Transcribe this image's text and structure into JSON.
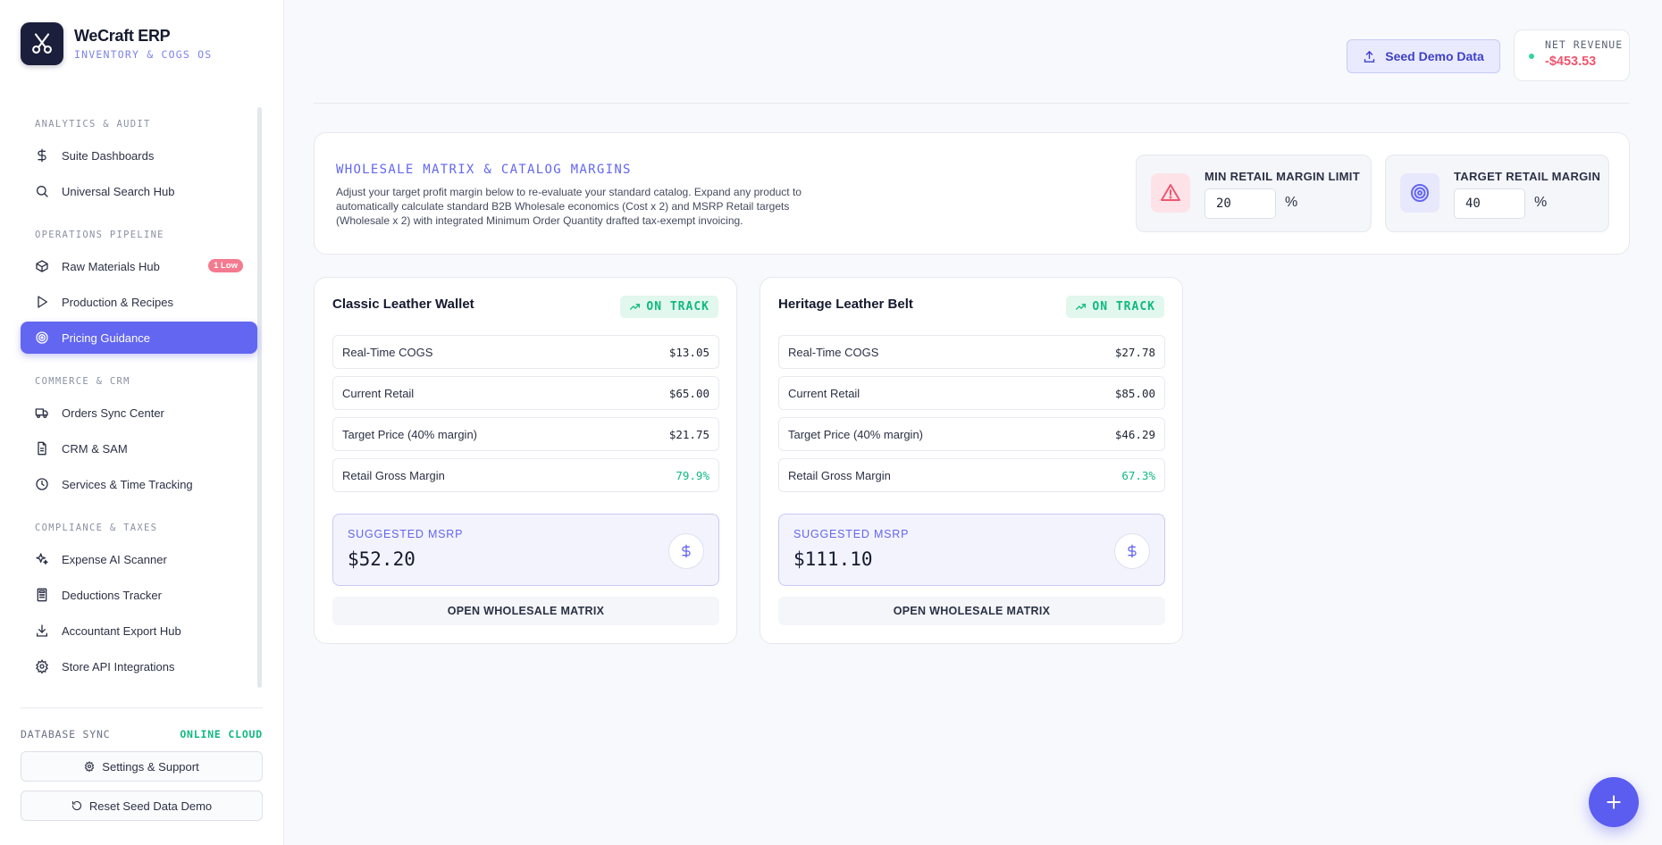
{
  "brand": {
    "name": "WeCraft ERP",
    "subtitle": "INVENTORY & COGS OS"
  },
  "sidebar": {
    "sections": [
      {
        "label": "ANALYTICS & AUDIT",
        "items": [
          {
            "label": "Suite Dashboards",
            "icon": "dollar-icon"
          },
          {
            "label": "Universal Search Hub",
            "icon": "search-icon"
          }
        ]
      },
      {
        "label": "OPERATIONS PIPELINE",
        "items": [
          {
            "label": "Raw Materials Hub",
            "icon": "package-icon",
            "badge": "1 Low"
          },
          {
            "label": "Production & Recipes",
            "icon": "play-icon"
          },
          {
            "label": "Pricing Guidance",
            "icon": "target-icon",
            "active": true
          }
        ]
      },
      {
        "label": "COMMERCE & CRM",
        "items": [
          {
            "label": "Orders Sync Center",
            "icon": "truck-icon"
          },
          {
            "label": "CRM & SAM",
            "icon": "file-icon"
          },
          {
            "label": "Services & Time Tracking",
            "icon": "clock-icon"
          }
        ]
      },
      {
        "label": "COMPLIANCE & TAXES",
        "items": [
          {
            "label": "Expense AI Scanner",
            "icon": "sparkles-icon"
          },
          {
            "label": "Deductions Tracker",
            "icon": "calculator-icon"
          },
          {
            "label": "Accountant Export Hub",
            "icon": "download-icon"
          },
          {
            "label": "Store API Integrations",
            "icon": "gear-icon"
          }
        ]
      }
    ],
    "footer": {
      "db_label": "DATABASE SYNC",
      "db_status": "ONLINE CLOUD",
      "settings_label": "Settings & Support",
      "reset_label": "Reset Seed Data Demo"
    }
  },
  "header": {
    "seed_label": "Seed Demo Data",
    "revenue_label": "NET REVENUE",
    "revenue_value": "-$453.53"
  },
  "info": {
    "title": "WHOLESALE MATRIX & CATALOG MARGINS",
    "description": "Adjust your target profit margin below to re-evaluate your standard catalog. Expand any product to automatically calculate standard B2B Wholesale economics (Cost x 2) and MSRP Retail targets (Wholesale x 2) with integrated Minimum Order Quantity drafted tax-exempt invoicing.",
    "min_margin": {
      "label": "MIN RETAIL MARGIN LIMIT",
      "value": "20",
      "unit": "%"
    },
    "target_margin": {
      "label": "TARGET RETAIL MARGIN",
      "value": "40",
      "unit": "%"
    }
  },
  "products": [
    {
      "name": "Classic Leather Wallet",
      "status": "ON TRACK",
      "rows": [
        {
          "label": "Real-Time COGS",
          "value": "$13.05"
        },
        {
          "label": "Current Retail",
          "value": "$65.00"
        },
        {
          "label": "Target Price (40% margin)",
          "value": "$21.75"
        },
        {
          "label": "Retail Gross Margin",
          "value": "79.9%",
          "highlight": true
        }
      ],
      "msrp_label": "SUGGESTED MSRP",
      "msrp_value": "$52.20",
      "button_label": "OPEN WHOLESALE MATRIX"
    },
    {
      "name": "Heritage Leather Belt",
      "status": "ON TRACK",
      "rows": [
        {
          "label": "Real-Time COGS",
          "value": "$27.78"
        },
        {
          "label": "Current Retail",
          "value": "$85.00"
        },
        {
          "label": "Target Price (40% margin)",
          "value": "$46.29"
        },
        {
          "label": "Retail Gross Margin",
          "value": "67.3%",
          "highlight": true
        }
      ],
      "msrp_label": "SUGGESTED MSRP",
      "msrp_value": "$111.10",
      "button_label": "OPEN WHOLESALE MATRIX"
    }
  ],
  "colors": {
    "accent": "#6366f1",
    "success": "#10b981",
    "danger": "#f0566f",
    "brand_dark": "#1b1f3b"
  }
}
